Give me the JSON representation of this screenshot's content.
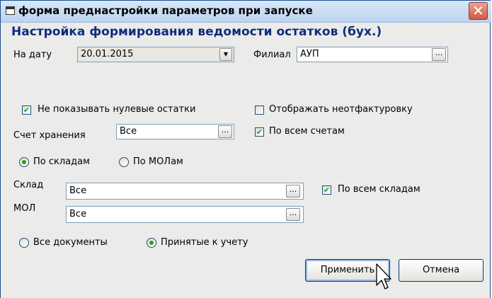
{
  "window": {
    "title": "форма преднастройки параметров при запуске",
    "close_symbol": "✕"
  },
  "heading": "Настройка формирования ведомости остатков (бух.)",
  "date": {
    "label": "На дату",
    "value": "20.01.2015",
    "button_symbol": "▼"
  },
  "branch": {
    "label": "Филиал",
    "value": "АУП",
    "button_symbol": "..."
  },
  "hide_zero": {
    "label": "Не показывать нулевые остатки",
    "checked": true
  },
  "show_uninvoiced": {
    "label": "Отображать неотфактуровку",
    "checked": false
  },
  "account": {
    "label": "Счет хранения",
    "value": "Все",
    "button_symbol": "..."
  },
  "all_accounts": {
    "label": "По всем счетам",
    "checked": true
  },
  "grouping": {
    "by_warehouse": "По складам",
    "by_mol": "По МОЛам",
    "selected": "by_warehouse"
  },
  "warehouse": {
    "label": "Склад",
    "value": "Все",
    "button_symbol": "..."
  },
  "all_warehouses": {
    "label": "По всем складам",
    "checked": true
  },
  "mol": {
    "label": "МОЛ",
    "value": "Все",
    "button_symbol": "..."
  },
  "documents": {
    "all": "Все документы",
    "accepted": "Принятые к учету",
    "selected": "accepted"
  },
  "buttons": {
    "apply": "Применить",
    "cancel": "Отмена"
  },
  "check_symbol": "✔"
}
